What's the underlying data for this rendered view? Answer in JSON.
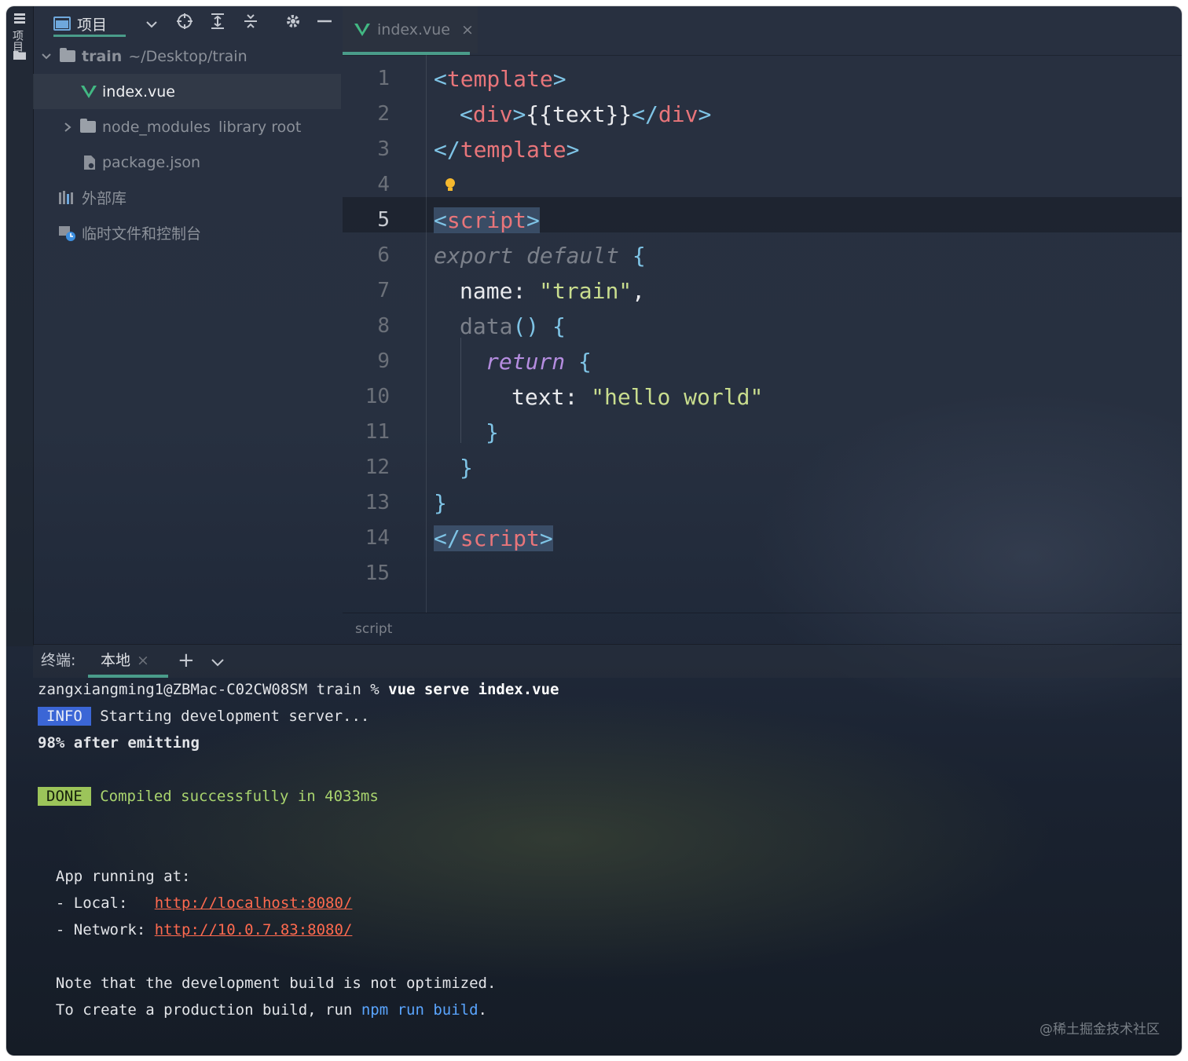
{
  "sidebar_strip": {
    "tab_label": "项目",
    "folder_icon": "folder-icon"
  },
  "project_panel": {
    "title": "项目",
    "tree": {
      "root_name": "train",
      "root_path": "~/Desktop/train",
      "file_selected": "index.vue",
      "node_modules": "node_modules",
      "node_modules_suffix": "library root",
      "package_json": "package.json",
      "external_libs": "外部库",
      "scratches": "临时文件和控制台"
    }
  },
  "editor": {
    "tab_label": "index.vue",
    "tab_close": "×",
    "line_numbers": [
      "1",
      "2",
      "3",
      "4",
      "5",
      "6",
      "7",
      "8",
      "9",
      "10",
      "11",
      "12",
      "13",
      "14",
      "15"
    ],
    "current_line": 5,
    "lines": {
      "l1": [
        "<",
        "template",
        ">"
      ],
      "l2": [
        "<",
        "div",
        ">",
        "{{text}}",
        "</",
        "div",
        ">"
      ],
      "l3": [
        "</",
        "template",
        ">"
      ],
      "l5": [
        "<",
        "script",
        ">"
      ],
      "l6": [
        "export default",
        " {"
      ],
      "l7": [
        "name",
        ": ",
        "\"train\"",
        ","
      ],
      "l8": [
        "data",
        "() {"
      ],
      "l9": [
        "return",
        " {"
      ],
      "l10": [
        "text",
        ": ",
        "\"hello world\""
      ],
      "l11": "}",
      "l12": "}",
      "l13": "}",
      "l14": [
        "</",
        "script",
        ">"
      ]
    },
    "breadcrumb": "script"
  },
  "terminal": {
    "label": "终端:",
    "tab_label": "本地",
    "tab_close": "×",
    "add": "+",
    "prompt": "zangxiangming1@ZBMac-C02CW08SM train % ",
    "command": "vue serve index.vue",
    "info_badge": "INFO",
    "info_text": " Starting development server...",
    "progress": "98% after emitting",
    "done_badge": "DONE",
    "done_text": " Compiled successfully in 4033ms",
    "app_running": "  App running at:",
    "local_label": "  - Local:   ",
    "local_url": "http://localhost:8080/",
    "network_label": "  - Network: ",
    "network_url": "http://10.0.7.83:8080/",
    "note1": "  Note that the development build is not optimized.",
    "note2_pre": "  To create a production build, run ",
    "note2_cmd": "npm run build",
    "note2_post": "."
  },
  "watermark": "@稀土掘金技术社区",
  "colors": {
    "accent": "#4a9c8a",
    "tag": "#e8757a",
    "bracket": "#7fc4e6",
    "string": "#c9dd8e",
    "keyword": "#b58de0",
    "vue_green": "#42b883",
    "link": "#ff6a4f",
    "info_bg": "#3b66d6",
    "done_bg": "#9cc45a"
  }
}
